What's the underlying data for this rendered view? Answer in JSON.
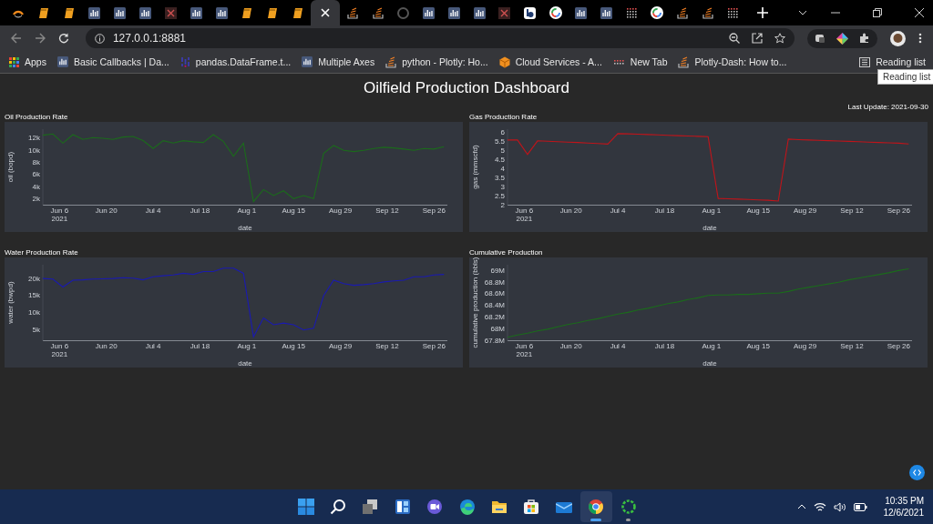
{
  "browser": {
    "tabs": [
      {
        "kind": "ring",
        "selected": false
      },
      {
        "kind": "book",
        "selected": false
      },
      {
        "kind": "book",
        "selected": false
      },
      {
        "kind": "bars",
        "selected": false
      },
      {
        "kind": "bars",
        "selected": false
      },
      {
        "kind": "bars",
        "selected": false
      },
      {
        "kind": "cross",
        "selected": false
      },
      {
        "kind": "bars",
        "selected": false
      },
      {
        "kind": "bars",
        "selected": false
      },
      {
        "kind": "book",
        "selected": false
      },
      {
        "kind": "book",
        "selected": false
      },
      {
        "kind": "book",
        "selected": false
      },
      {
        "kind": "close",
        "selected": true
      },
      {
        "kind": "stack",
        "selected": false
      },
      {
        "kind": "stack",
        "selected": false
      },
      {
        "kind": "cat",
        "selected": false
      },
      {
        "kind": "bars",
        "selected": false
      },
      {
        "kind": "bars",
        "selected": false
      },
      {
        "kind": "bars",
        "selected": false
      },
      {
        "kind": "cross",
        "selected": false
      },
      {
        "kind": "badge",
        "selected": false
      },
      {
        "kind": "gring",
        "selected": false
      },
      {
        "kind": "bars",
        "selected": false
      },
      {
        "kind": "bars",
        "selected": false
      },
      {
        "kind": "dots",
        "selected": false
      },
      {
        "kind": "gring",
        "selected": false
      },
      {
        "kind": "stack",
        "selected": false
      },
      {
        "kind": "stack",
        "selected": false
      },
      {
        "kind": "dots",
        "selected": false
      }
    ],
    "url": "127.0.0.1:8881",
    "bookmarks": [
      {
        "label": "Apps",
        "kind": "apps"
      },
      {
        "label": "Basic Callbacks | Da...",
        "kind": "bars"
      },
      {
        "label": "pandas.DataFrame.t...",
        "kind": "pandas"
      },
      {
        "label": "Multiple Axes",
        "kind": "bars"
      },
      {
        "label": "python - Plotly: Ho...",
        "kind": "stack"
      },
      {
        "label": "Cloud Services - A...",
        "kind": "cube"
      },
      {
        "label": "New Tab",
        "kind": "dots"
      },
      {
        "label": "Plotly-Dash: How to...",
        "kind": "stack"
      }
    ],
    "reading_list": "Reading list",
    "tooltip": "Reading list"
  },
  "page": {
    "title": "Oilfield Production Dashboard",
    "last_update": "Last Update: 2021-09-30",
    "panels": [
      {
        "title": "Oil Production Rate",
        "chart_data": {
          "type": "line",
          "xlabel": "date",
          "ylabel": "oil (bopd)",
          "x": [
            "2021-06-01",
            "2021-06-04",
            "2021-06-07",
            "2021-06-10",
            "2021-06-13",
            "2021-06-16",
            "2021-06-19",
            "2021-06-22",
            "2021-06-25",
            "2021-06-28",
            "2021-07-01",
            "2021-07-04",
            "2021-07-07",
            "2021-07-10",
            "2021-07-13",
            "2021-07-16",
            "2021-07-19",
            "2021-07-22",
            "2021-07-25",
            "2021-07-28",
            "2021-07-31",
            "2021-08-03",
            "2021-08-06",
            "2021-08-09",
            "2021-08-12",
            "2021-08-15",
            "2021-08-18",
            "2021-08-21",
            "2021-08-24",
            "2021-08-27",
            "2021-08-30",
            "2021-09-02",
            "2021-09-05",
            "2021-09-08",
            "2021-09-11",
            "2021-09-14",
            "2021-09-17",
            "2021-09-20",
            "2021-09-23",
            "2021-09-26",
            "2021-09-29"
          ],
          "series": [
            {
              "color": "#1b6b1b",
              "values": [
                12500,
                12700,
                11200,
                12600,
                11800,
                12100,
                12000,
                11800,
                12200,
                12300,
                11600,
                10300,
                11600,
                11200,
                11600,
                11400,
                11300,
                12600,
                11500,
                9000,
                11200,
                1500,
                3500,
                2500,
                3300,
                2000,
                2500,
                2000,
                9500,
                10800,
                10000,
                9800,
                10000,
                10300,
                10500,
                10400,
                10200,
                10000,
                10300,
                10200,
                10600
              ]
            }
          ],
          "xlim": [
            "2021-06-01",
            "2021-09-30"
          ],
          "ylim": [
            1000,
            13500
          ],
          "xticks": [
            {
              "value": "2021-06-06",
              "label": "Jun 6\n2021"
            },
            {
              "value": "2021-06-20",
              "label": "Jun 20"
            },
            {
              "value": "2021-07-04",
              "label": "Jul 4"
            },
            {
              "value": "2021-07-18",
              "label": "Jul 18"
            },
            {
              "value": "2021-08-01",
              "label": "Aug 1"
            },
            {
              "value": "2021-08-15",
              "label": "Aug 15"
            },
            {
              "value": "2021-08-29",
              "label": "Aug 29"
            },
            {
              "value": "2021-09-12",
              "label": "Sep 12"
            },
            {
              "value": "2021-09-26",
              "label": "Sep 26"
            }
          ],
          "yticks": [
            {
              "value": 2000,
              "label": "2k"
            },
            {
              "value": 4000,
              "label": "4k"
            },
            {
              "value": 6000,
              "label": "6k"
            },
            {
              "value": 8000,
              "label": "8k"
            },
            {
              "value": 10000,
              "label": "10k"
            },
            {
              "value": 12000,
              "label": "12k"
            }
          ]
        }
      },
      {
        "title": "Gas Production Rate",
        "chart_data": {
          "type": "line",
          "xlabel": "date",
          "ylabel": "gas (mmscfd)",
          "x": [
            "2021-06-01",
            "2021-06-04",
            "2021-06-07",
            "2021-06-10",
            "2021-06-13",
            "2021-06-16",
            "2021-06-19",
            "2021-06-22",
            "2021-06-25",
            "2021-06-28",
            "2021-07-01",
            "2021-07-04",
            "2021-07-07",
            "2021-07-10",
            "2021-07-13",
            "2021-07-16",
            "2021-07-19",
            "2021-07-22",
            "2021-07-25",
            "2021-07-28",
            "2021-07-31",
            "2021-08-03",
            "2021-08-06",
            "2021-08-09",
            "2021-08-12",
            "2021-08-15",
            "2021-08-18",
            "2021-08-21",
            "2021-08-24",
            "2021-08-27",
            "2021-08-30",
            "2021-09-02",
            "2021-09-05",
            "2021-09-08",
            "2021-09-11",
            "2021-09-14",
            "2021-09-17",
            "2021-09-20",
            "2021-09-23",
            "2021-09-26",
            "2021-09-29"
          ],
          "series": [
            {
              "color": "#c0141a",
              "values": [
                5.6,
                5.6,
                4.8,
                5.55,
                5.53,
                5.5,
                5.48,
                5.46,
                5.43,
                5.4,
                5.37,
                5.95,
                5.94,
                5.92,
                5.9,
                5.88,
                5.86,
                5.84,
                5.82,
                5.8,
                5.78,
                2.35,
                2.33,
                2.31,
                2.29,
                2.27,
                2.25,
                2.2,
                5.65,
                5.62,
                5.6,
                5.58,
                5.56,
                5.54,
                5.52,
                5.5,
                5.48,
                5.46,
                5.44,
                5.42,
                5.38
              ]
            }
          ],
          "xlim": [
            "2021-06-01",
            "2021-09-30"
          ],
          "ylim": [
            2,
            6.2
          ],
          "xticks": [
            {
              "value": "2021-06-06",
              "label": "Jun 6\n2021"
            },
            {
              "value": "2021-06-20",
              "label": "Jun 20"
            },
            {
              "value": "2021-07-04",
              "label": "Jul 4"
            },
            {
              "value": "2021-07-18",
              "label": "Jul 18"
            },
            {
              "value": "2021-08-01",
              "label": "Aug 1"
            },
            {
              "value": "2021-08-15",
              "label": "Aug 15"
            },
            {
              "value": "2021-08-29",
              "label": "Aug 29"
            },
            {
              "value": "2021-09-12",
              "label": "Sep 12"
            },
            {
              "value": "2021-09-26",
              "label": "Sep 26"
            }
          ],
          "yticks": [
            2,
            2.5,
            3,
            3.5,
            4,
            4.5,
            5,
            5.5,
            6
          ]
        }
      },
      {
        "title": "Water Production Rate",
        "chart_data": {
          "type": "line",
          "xlabel": "date",
          "ylabel": "water (bwpd)",
          "x": [
            "2021-06-01",
            "2021-06-04",
            "2021-06-07",
            "2021-06-10",
            "2021-06-13",
            "2021-06-16",
            "2021-06-19",
            "2021-06-22",
            "2021-06-25",
            "2021-06-28",
            "2021-07-01",
            "2021-07-04",
            "2021-07-07",
            "2021-07-10",
            "2021-07-13",
            "2021-07-16",
            "2021-07-19",
            "2021-07-22",
            "2021-07-25",
            "2021-07-28",
            "2021-07-31",
            "2021-08-03",
            "2021-08-06",
            "2021-08-09",
            "2021-08-12",
            "2021-08-15",
            "2021-08-18",
            "2021-08-21",
            "2021-08-24",
            "2021-08-27",
            "2021-08-30",
            "2021-09-02",
            "2021-09-05",
            "2021-09-08",
            "2021-09-11",
            "2021-09-14",
            "2021-09-17",
            "2021-09-20",
            "2021-09-23",
            "2021-09-26",
            "2021-09-29"
          ],
          "series": [
            {
              "color": "#1a1ab0",
              "values": [
                20000,
                19800,
                17500,
                19500,
                19600,
                19800,
                19900,
                20000,
                20200,
                20100,
                19600,
                20500,
                20800,
                21000,
                21500,
                21200,
                22000,
                22000,
                23000,
                23000,
                21500,
                3000,
                8500,
                6500,
                7000,
                6500,
                5000,
                5500,
                15000,
                19500,
                18500,
                18000,
                18200,
                18500,
                19000,
                19300,
                19500,
                20500,
                20500,
                21000,
                21200
              ]
            }
          ],
          "xlim": [
            "2021-06-01",
            "2021-09-30"
          ],
          "ylim": [
            2000,
            24000
          ],
          "xticks": [
            {
              "value": "2021-06-06",
              "label": "Jun 6\n2021"
            },
            {
              "value": "2021-06-20",
              "label": "Jun 20"
            },
            {
              "value": "2021-07-04",
              "label": "Jul 4"
            },
            {
              "value": "2021-07-18",
              "label": "Jul 18"
            },
            {
              "value": "2021-08-01",
              "label": "Aug 1"
            },
            {
              "value": "2021-08-15",
              "label": "Aug 15"
            },
            {
              "value": "2021-08-29",
              "label": "Aug 29"
            },
            {
              "value": "2021-09-12",
              "label": "Sep 12"
            },
            {
              "value": "2021-09-26",
              "label": "Sep 26"
            }
          ],
          "yticks": [
            {
              "value": 5000,
              "label": "5k"
            },
            {
              "value": 10000,
              "label": "10k"
            },
            {
              "value": 15000,
              "label": "15k"
            },
            {
              "value": 20000,
              "label": "20k"
            }
          ]
        }
      },
      {
        "title": "Cumulative Production",
        "chart_data": {
          "type": "line",
          "xlabel": "date",
          "ylabel": "cumulative production (bbls)",
          "x": [
            "2021-06-01",
            "2021-06-04",
            "2021-06-07",
            "2021-06-10",
            "2021-06-13",
            "2021-06-16",
            "2021-06-19",
            "2021-06-22",
            "2021-06-25",
            "2021-06-28",
            "2021-07-01",
            "2021-07-04",
            "2021-07-07",
            "2021-07-10",
            "2021-07-13",
            "2021-07-16",
            "2021-07-19",
            "2021-07-22",
            "2021-07-25",
            "2021-07-28",
            "2021-07-31",
            "2021-08-03",
            "2021-08-06",
            "2021-08-09",
            "2021-08-12",
            "2021-08-15",
            "2021-08-18",
            "2021-08-21",
            "2021-08-24",
            "2021-08-27",
            "2021-08-30",
            "2021-09-02",
            "2021-09-05",
            "2021-09-08",
            "2021-09-11",
            "2021-09-14",
            "2021-09-17",
            "2021-09-20",
            "2021-09-23",
            "2021-09-26",
            "2021-09-29"
          ],
          "series": [
            {
              "color": "#1b6b1b",
              "values": [
                67850000,
                67890000,
                67920000,
                67960000,
                67990000,
                68030000,
                68070000,
                68100000,
                68140000,
                68170000,
                68210000,
                68250000,
                68280000,
                68320000,
                68350000,
                68390000,
                68430000,
                68460000,
                68500000,
                68530000,
                68570000,
                68580000,
                68580000,
                68590000,
                68590000,
                68600000,
                68610000,
                68610000,
                68640000,
                68680000,
                68710000,
                68740000,
                68770000,
                68800000,
                68840000,
                68870000,
                68900000,
                68930000,
                68960000,
                69000000,
                69030000
              ]
            }
          ],
          "xlim": [
            "2021-06-01",
            "2021-09-30"
          ],
          "ylim": [
            67800000,
            69100000
          ],
          "xticks": [
            {
              "value": "2021-06-06",
              "label": "Jun 6\n2021"
            },
            {
              "value": "2021-06-20",
              "label": "Jun 20"
            },
            {
              "value": "2021-07-04",
              "label": "Jul 4"
            },
            {
              "value": "2021-07-18",
              "label": "Jul 18"
            },
            {
              "value": "2021-08-01",
              "label": "Aug 1"
            },
            {
              "value": "2021-08-15",
              "label": "Aug 15"
            },
            {
              "value": "2021-08-29",
              "label": "Aug 29"
            },
            {
              "value": "2021-09-12",
              "label": "Sep 12"
            },
            {
              "value": "2021-09-26",
              "label": "Sep 26"
            }
          ],
          "yticks": [
            {
              "value": 67800000,
              "label": "67.8M"
            },
            {
              "value": 68000000,
              "label": "68M"
            },
            {
              "value": 68200000,
              "label": "68.2M"
            },
            {
              "value": 68400000,
              "label": "68.4M"
            },
            {
              "value": 68600000,
              "label": "68.6M"
            },
            {
              "value": 68800000,
              "label": "68.8M"
            },
            {
              "value": 69000000,
              "label": "69M"
            }
          ]
        }
      }
    ]
  },
  "taskbar": {
    "apps": [
      {
        "kind": "start",
        "selected": false,
        "running": false
      },
      {
        "kind": "search",
        "selected": false,
        "running": false
      },
      {
        "kind": "views",
        "selected": false,
        "running": false
      },
      {
        "kind": "widgets",
        "selected": false,
        "running": false
      },
      {
        "kind": "chat",
        "selected": false,
        "running": false
      },
      {
        "kind": "edge",
        "selected": false,
        "running": false
      },
      {
        "kind": "folder",
        "selected": false,
        "running": false
      },
      {
        "kind": "store",
        "selected": false,
        "running": false
      },
      {
        "kind": "mail",
        "selected": false,
        "running": false
      },
      {
        "kind": "chrome",
        "selected": true,
        "running": true
      },
      {
        "kind": "loader",
        "selected": false,
        "running": true
      }
    ],
    "time": "10:35 PM",
    "date": "12/6/2021"
  }
}
